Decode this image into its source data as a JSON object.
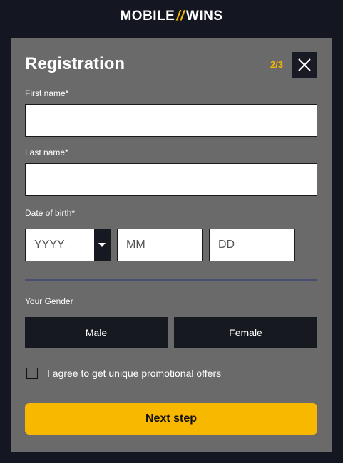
{
  "brand": {
    "left": "MOBILE",
    "separator": "//",
    "right": "WINS"
  },
  "form": {
    "title": "Registration",
    "step": "2/3",
    "first_name_label": "First name*",
    "first_name_value": "",
    "last_name_label": "Last name*",
    "last_name_value": "",
    "dob_label": "Date of birth*",
    "dob": {
      "year_placeholder": "YYYY",
      "month_placeholder": "MM",
      "day_placeholder": "DD"
    },
    "gender_label": "Your Gender",
    "gender_options": [
      "Male",
      "Female"
    ],
    "agree_text": "I agree to get unique promotional offers",
    "agree_checked": false,
    "submit_label": "Next step"
  },
  "colors": {
    "accent": "#f8b800",
    "panel": "#6a6a6a",
    "background": "#141722",
    "dark_button": "#16191f",
    "divider": "#4a4d72"
  },
  "icons": {
    "close": "close-icon",
    "dropdown": "chevron-down-icon"
  }
}
